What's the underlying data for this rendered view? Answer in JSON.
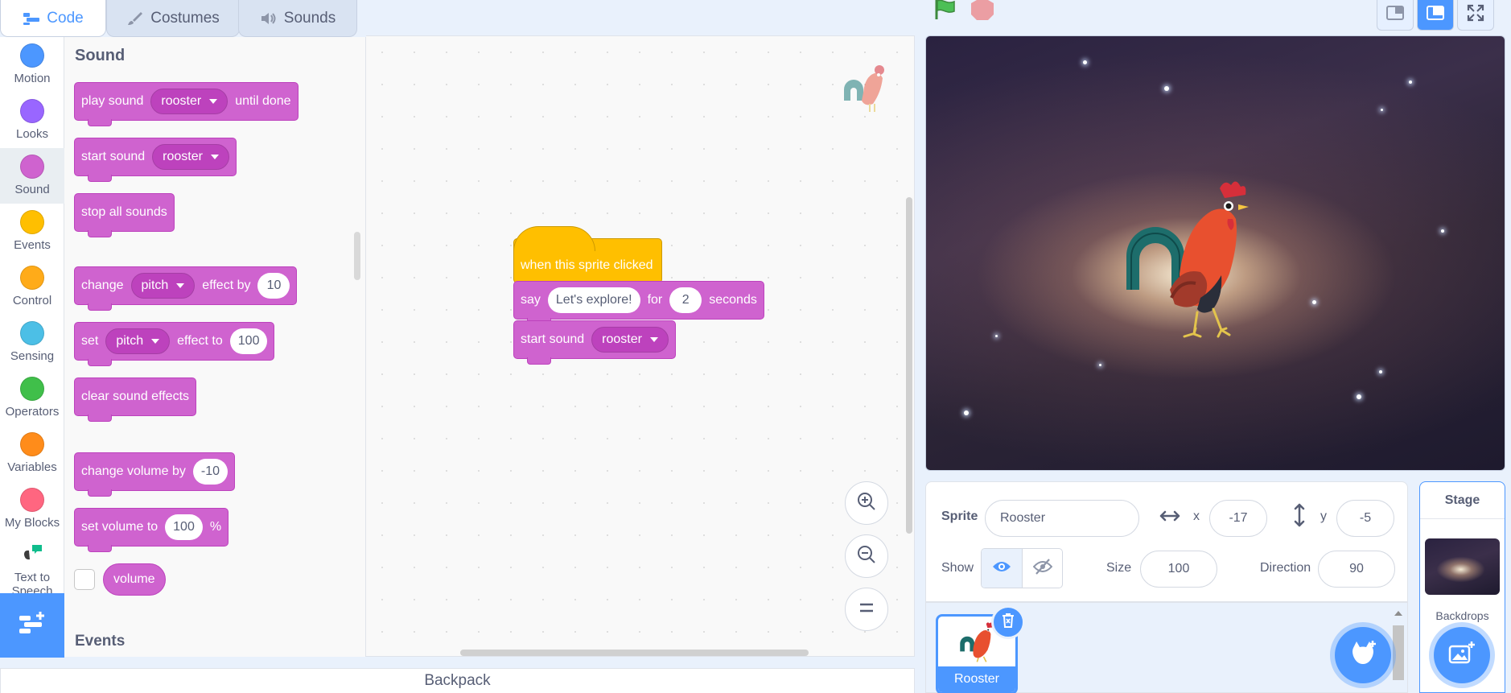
{
  "tabs": [
    {
      "label": "Code",
      "icon": "code-icon",
      "active": true
    },
    {
      "label": "Costumes",
      "icon": "brush-icon"
    },
    {
      "label": "Sounds",
      "icon": "speaker-icon"
    }
  ],
  "categories": [
    {
      "label": "Motion",
      "color": "#4c97ff"
    },
    {
      "label": "Looks",
      "color": "#9966ff"
    },
    {
      "label": "Sound",
      "color": "#cf63cf",
      "active": true
    },
    {
      "label": "Events",
      "color": "#ffbf00"
    },
    {
      "label": "Control",
      "color": "#ffab19"
    },
    {
      "label": "Sensing",
      "color": "#4cbfe6"
    },
    {
      "label": "Operators",
      "color": "#40bf4a"
    },
    {
      "label": "Variables",
      "color": "#ff8c1a"
    },
    {
      "label": "My Blocks",
      "color": "#ff6680"
    },
    {
      "label": "Text to Speech",
      "color": "#0fbd8c"
    }
  ],
  "palette": {
    "section_sound": "Sound",
    "section_events": "Events",
    "play_sound": {
      "label": "play sound",
      "sound": "rooster",
      "suffix": "until done"
    },
    "start_sound": {
      "label": "start sound",
      "sound": "rooster"
    },
    "stop_all": {
      "label": "stop all sounds"
    },
    "change_effect": {
      "label": "change",
      "effect": "pitch",
      "mid": "effect by",
      "value": "10"
    },
    "set_effect": {
      "label": "set",
      "effect": "pitch",
      "mid": "effect to",
      "value": "100"
    },
    "clear_effects": {
      "label": "clear sound effects"
    },
    "change_volume": {
      "label": "change volume by",
      "value": "-10"
    },
    "set_volume": {
      "label": "set volume to",
      "value": "100",
      "suffix": "%"
    },
    "volume_reporter": {
      "label": "volume"
    }
  },
  "script": {
    "hat": "when this sprite clicked",
    "say": {
      "label": "say",
      "text": "Let's explore!",
      "mid": "for",
      "value": "2",
      "suffix": "seconds"
    },
    "start_sound": {
      "label": "start sound",
      "sound": "rooster"
    }
  },
  "backpack": {
    "label": "Backpack"
  },
  "sprite_info": {
    "sprite_label": "Sprite",
    "sprite_name": "Rooster",
    "x_label": "x",
    "x_value": "-17",
    "y_label": "y",
    "y_value": "-5",
    "show_label": "Show",
    "size_label": "Size",
    "size_value": "100",
    "direction_label": "Direction",
    "direction_value": "90"
  },
  "sprites": [
    {
      "name": "Rooster",
      "selected": true
    }
  ],
  "stage_panel": {
    "title": "Stage",
    "backdrops_label": "Backdrops"
  },
  "colors": {
    "accent": "#4c97ff",
    "sound_block": "#cf63cf",
    "event_block": "#ffbf00"
  }
}
